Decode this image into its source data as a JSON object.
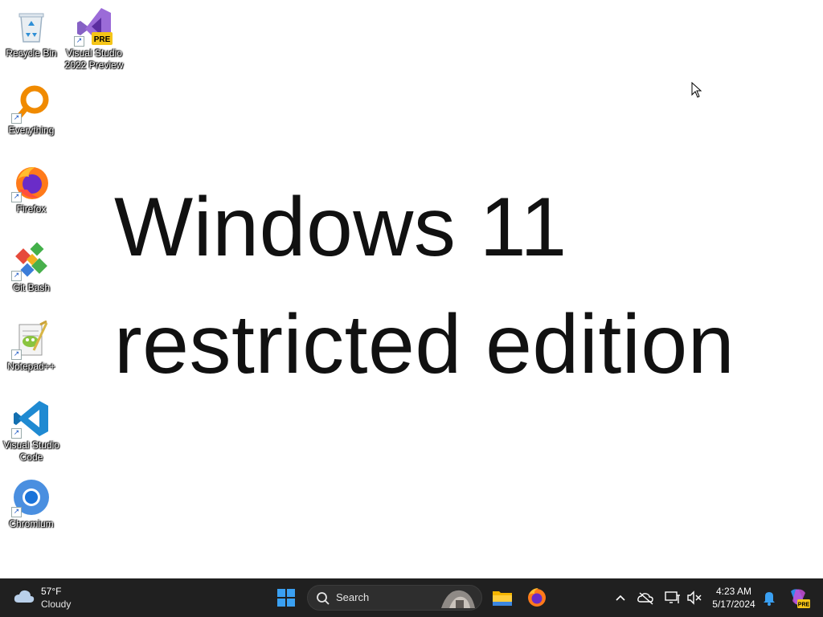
{
  "desktop": {
    "icons": [
      {
        "label": "Recycle Bin"
      },
      {
        "label": "Visual Studio 2022 Preview",
        "badge": "PRE"
      },
      {
        "label": "Everything"
      },
      {
        "label": "Firefox"
      },
      {
        "label": "Git Bash"
      },
      {
        "label": "Notepad++"
      },
      {
        "label": "Visual Studio Code"
      },
      {
        "label": "Chromium"
      }
    ],
    "headline_line1": "Windows 11",
    "headline_line2": "restricted edition"
  },
  "taskbar": {
    "weather": {
      "temp": "57°F",
      "condition": "Cloudy"
    },
    "search_label": "Search",
    "clock": {
      "time": "4:23 AM",
      "date": "5/17/2024"
    },
    "copilot_badge": "PRE",
    "accent": "#0078d4"
  }
}
